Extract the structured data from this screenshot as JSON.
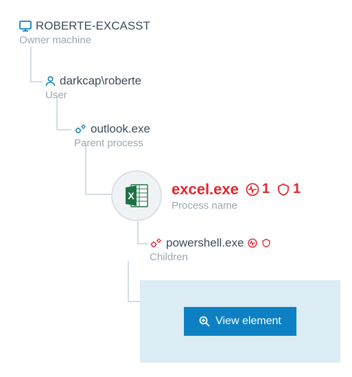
{
  "tree": {
    "machine": {
      "name": "ROBERTE-EXCASST",
      "sub": "Owner machine"
    },
    "user": {
      "name": "darkcap\\roberte",
      "sub": "User"
    },
    "parent": {
      "name": "outlook.exe",
      "sub": "Parent process"
    },
    "process": {
      "name": "excel.exe",
      "sub": "Process name",
      "badges": {
        "pulse": 1,
        "shield": 1
      },
      "icon": "excel-app-icon"
    },
    "child": {
      "name": "powershell.exe",
      "sub": "Children",
      "flags": {
        "pulse": true,
        "shield": true
      }
    }
  },
  "panel": {
    "button": "View element"
  },
  "colors": {
    "accent_blue": "#0d80c3",
    "danger_red": "#e1262d",
    "muted": "#9aa7b0",
    "line": "#d2dde3",
    "panel_bg": "#dcecf4",
    "excel_green": "#1e7145"
  }
}
